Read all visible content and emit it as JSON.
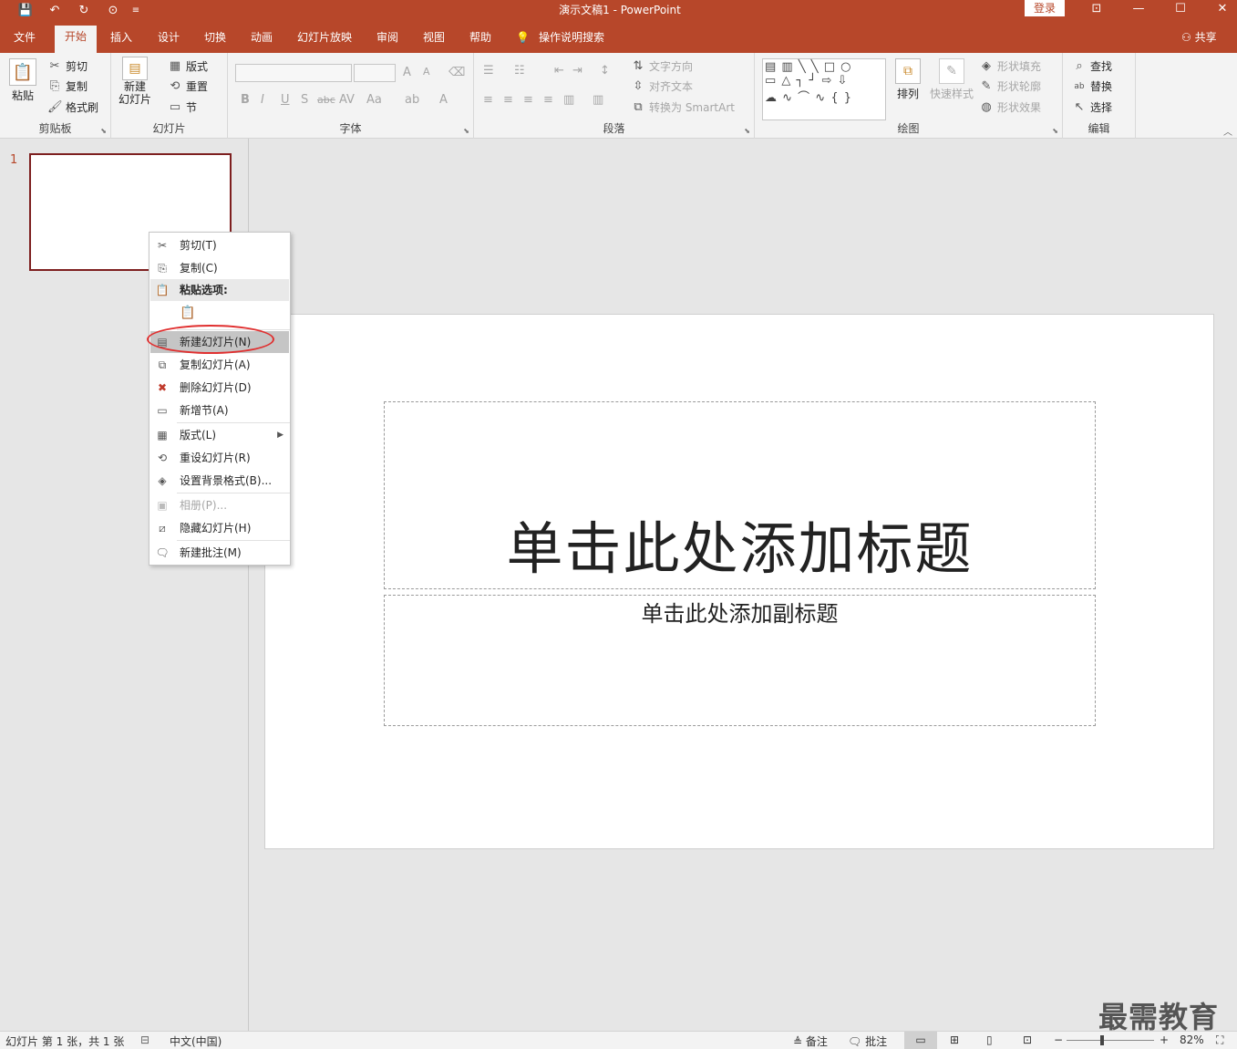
{
  "window": {
    "title": "演示文稿1  -  PowerPoint",
    "login_label": "登录",
    "qat": {
      "save_glyph": "💾",
      "undo_glyph": "↶",
      "redo_glyph": "↻",
      "present_glyph": "⊙",
      "customize_glyph": "≡"
    },
    "controls": {
      "ribbon_display_glyph": "⊡",
      "minimize_glyph": "—",
      "maximize_glyph": "☐",
      "close_glyph": "✕"
    }
  },
  "tabs": [
    "文件",
    "开始",
    "插入",
    "设计",
    "切换",
    "动画",
    "幻灯片放映",
    "审阅",
    "视图",
    "帮助"
  ],
  "tell_me": {
    "icon": "lightbulb-icon",
    "glyph": "💡",
    "label": "操作说明搜索"
  },
  "share_label": "共享",
  "ribbon": {
    "clipboard": {
      "label": "剪贴板",
      "paste": "粘贴",
      "cut": "剪切",
      "copy": "复制",
      "format_painter": "格式刷"
    },
    "slides": {
      "label": "幻灯片",
      "new_slide_line1": "新建",
      "new_slide_line2": "幻灯片",
      "layout": "版式",
      "reset": "重置",
      "section": "节"
    },
    "font": {
      "label": "字体",
      "bold": "B",
      "italic": "I",
      "underline": "U",
      "shadow": "S",
      "strike": "abc",
      "spacing": "AV",
      "case": "Aa",
      "grow": "A",
      "shrink": "A",
      "color": "A"
    },
    "paragraph": {
      "label": "段落",
      "text_direction": "文字方向",
      "align_text": "对齐文本",
      "smartart": "转换为 SmartArt"
    },
    "drawing": {
      "label": "绘图",
      "arrange": "排列",
      "quick_styles": "快速样式",
      "shape_fill": "形状填充",
      "shape_outline": "形状轮廓",
      "shape_effects": "形状效果",
      "shapes_row1": "▤ ▥ ╲ ╲ □ ○",
      "shapes_row2": "▭ △ ┐ ┘ ⇨ ⇩",
      "shapes_row3": "☁ ∿ ⌒ ∿ { }"
    },
    "editing": {
      "label": "编辑",
      "find": "查找",
      "replace": "替换",
      "select": "选择"
    }
  },
  "thumbnails": {
    "slide_number": "1"
  },
  "slide": {
    "title_placeholder": "单击此处添加标题",
    "subtitle_placeholder": "单击此处添加副标题"
  },
  "context_menu": {
    "cut": "剪切(T)",
    "copy": "复制(C)",
    "paste_options": "粘贴选项:",
    "new_slide": "新建幻灯片(N)",
    "duplicate_slide": "复制幻灯片(A)",
    "delete_slide": "删除幻灯片(D)",
    "add_section": "新增节(A)",
    "layout": "版式(L)",
    "reset_slide": "重设幻灯片(R)",
    "format_background": "设置背景格式(B)...",
    "photo_album": "相册(P)...",
    "hide_slide": "隐藏幻灯片(H)",
    "new_comment": "新建批注(M)"
  },
  "status": {
    "slide_info": "幻灯片 第 1 张，共 1 张",
    "language": "中文(中国)",
    "notes": "备注",
    "comments": "批注",
    "zoom_minus": "−",
    "zoom_plus": "+",
    "zoom": "82%",
    "zoom_fraction": 0.41
  },
  "watermark": "最需教育",
  "colors": {
    "accent": "#b7472a",
    "thumb_border": "#7d1f1f",
    "highlight_ring": "#e03030"
  }
}
